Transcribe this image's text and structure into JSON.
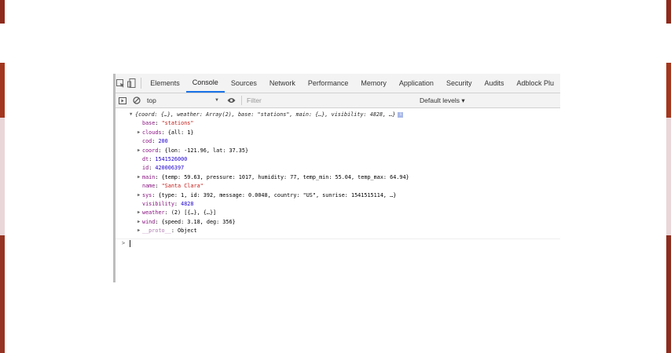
{
  "devtools": {
    "tabs": [
      "Elements",
      "Console",
      "Sources",
      "Network",
      "Performance",
      "Memory",
      "Application",
      "Security",
      "Audits",
      "Adblock Plu"
    ],
    "active_tab": "Console",
    "toolbar": {
      "context": "top",
      "filter_placeholder": "Filter",
      "levels": "Default levels ▾"
    },
    "console": {
      "summary": "{coord: {…}, weather: Array(2), base: \"stations\", main: {…}, visibility: 4828, …}",
      "summary_info": "i",
      "lines": [
        {
          "key": "base",
          "value": "\"stations\"",
          "vtype": "s",
          "expandable": false
        },
        {
          "key": "clouds",
          "value": "{all: 1}",
          "vtype": "o",
          "expandable": true
        },
        {
          "key": "cod",
          "value": "200",
          "vtype": "n",
          "expandable": false
        },
        {
          "key": "coord",
          "value": "{lon: -121.96, lat: 37.35}",
          "vtype": "o",
          "expandable": true
        },
        {
          "key": "dt",
          "value": "1541526000",
          "vtype": "n",
          "expandable": false
        },
        {
          "key": "id",
          "value": "420006397",
          "vtype": "n",
          "expandable": false
        },
        {
          "key": "main",
          "value": "{temp: 59.63, pressure: 1017, humidity: 77, temp_min: 55.04, temp_max: 64.94}",
          "vtype": "o",
          "expandable": true
        },
        {
          "key": "name",
          "value": "\"Santa Clara\"",
          "vtype": "s",
          "expandable": false
        },
        {
          "key": "sys",
          "value": "{type: 1, id: 392, message: 0.0048, country: \"US\", sunrise: 1541515114, …}",
          "vtype": "o",
          "expandable": true
        },
        {
          "key": "visibility",
          "value": "4828",
          "vtype": "n",
          "expandable": false
        },
        {
          "key": "weather",
          "value": "(2) [{…}, {…}]",
          "vtype": "o",
          "expandable": true
        },
        {
          "key": "wind",
          "value": "{speed: 3.18, deg: 356}",
          "vtype": "o",
          "expandable": true
        },
        {
          "key": "__proto__",
          "value": "Object",
          "vtype": "o",
          "expandable": true,
          "dim": true
        }
      ],
      "prompt": ">"
    }
  }
}
